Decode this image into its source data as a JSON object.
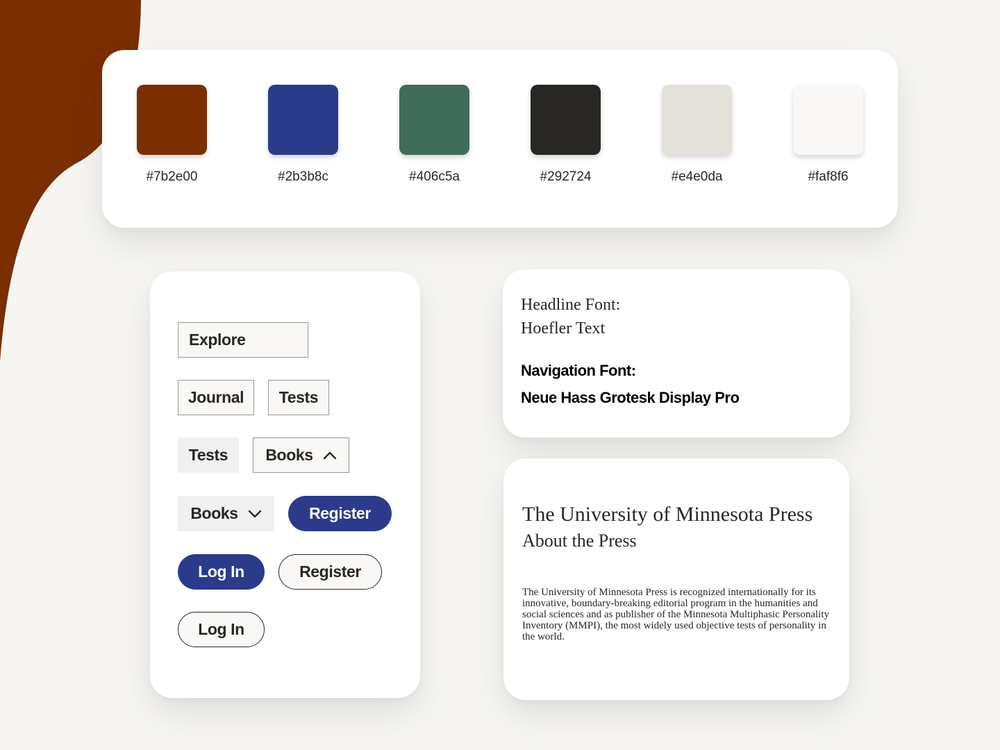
{
  "colors": {
    "accent_brown": "#7b2e00",
    "navy": "#2b3b8c",
    "green": "#406c5a",
    "charcoal": "#292724",
    "stone": "#e4e0da",
    "cream": "#faf8f6",
    "page_background": "#f6f5f2"
  },
  "palette": {
    "swatches": [
      {
        "color": "#7b2e00",
        "label": "#7b2e00"
      },
      {
        "color": "#2b3b8c",
        "label": "#2b3b8c"
      },
      {
        "color": "#406c5a",
        "label": "#406c5a"
      },
      {
        "color": "#292724",
        "label": "#292724"
      },
      {
        "color": "#e4e0da",
        "label": "#e4e0da"
      },
      {
        "color": "#faf8f6",
        "label": "#faf8f6"
      }
    ]
  },
  "buttons": {
    "explore": "Explore",
    "journal": "Journal",
    "tests_outlined": "Tests",
    "tests_flat": "Tests",
    "books_expanded": "Books",
    "books_collapsed": "Books",
    "register_solid": "Register",
    "login_solid": "Log In",
    "register_outline": "Register",
    "login_outline": "Log In"
  },
  "fonts": {
    "headline_label": "Headline Font:",
    "headline_name": "Hoefler Text",
    "navigation_label": "Navigation Font:",
    "navigation_name": "Neue Hass Grotesk Display Pro"
  },
  "about": {
    "title": "The University of Minnesota Press",
    "subtitle": "About the Press",
    "body": "The University of Minnesota Press is recognized internationally for its innovative, boundary-breaking editorial program in the humanities and social sciences and as publisher of the Minnesota Multiphasic Personality Inventory (MMPI), the most widely used objective tests of personality in the world."
  }
}
